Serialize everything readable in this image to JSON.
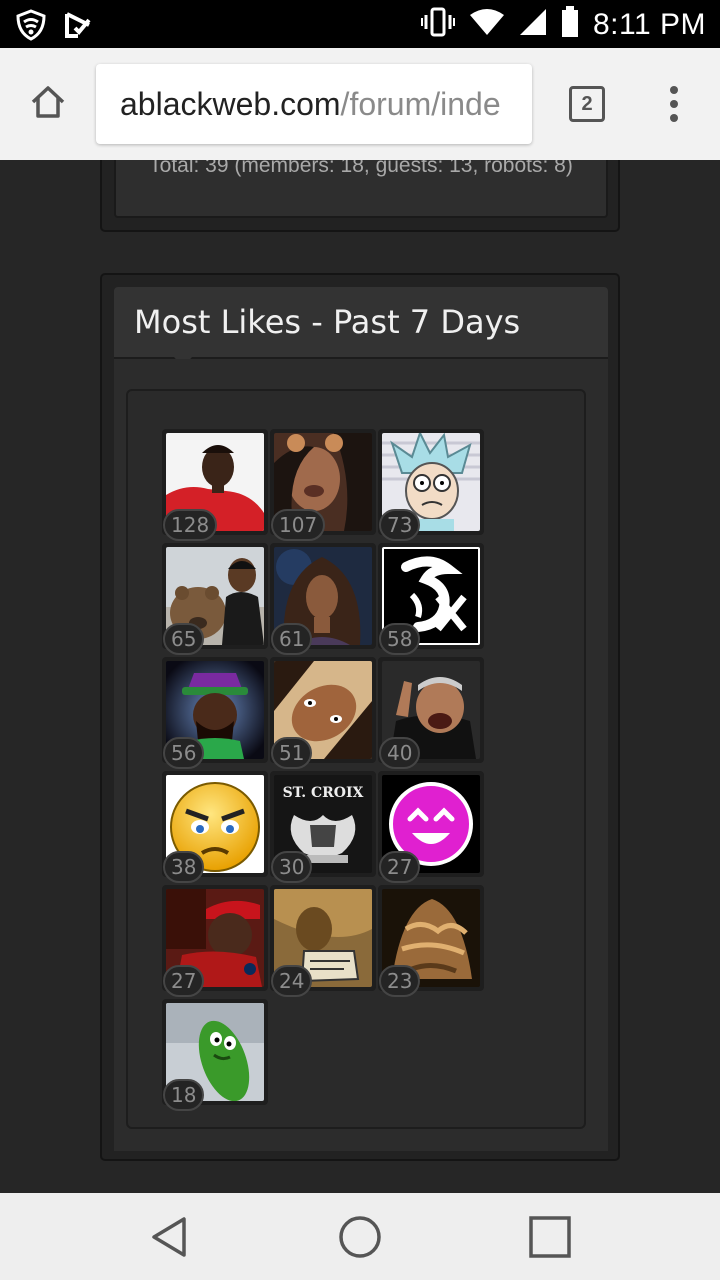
{
  "status_bar": {
    "time": "8:11 PM",
    "icons": [
      "lookout-shield-icon",
      "checklist-icon",
      "vibrate-icon",
      "wifi-icon",
      "cell-signal-icon",
      "battery-icon"
    ]
  },
  "browser": {
    "url_host": "ablackweb.com",
    "url_path": "/forum/inde",
    "tab_count": "2"
  },
  "online": {
    "total_text": "Total: 39 (members: 18, guests: 13, robots: 8)"
  },
  "most_likes": {
    "title": "Most Likes - Past 7 Days",
    "users": [
      {
        "likes": "128",
        "avatar": "red-shirt-man"
      },
      {
        "likes": "107",
        "avatar": "woman-selfie"
      },
      {
        "likes": "73",
        "avatar": "rick-cartoon"
      },
      {
        "likes": "65",
        "avatar": "man-with-bear"
      },
      {
        "likes": "61",
        "avatar": "woman-portrait"
      },
      {
        "likes": "58",
        "avatar": "white-sox-logo"
      },
      {
        "likes": "56",
        "avatar": "green-hat-character"
      },
      {
        "likes": "51",
        "avatar": "tilted-face"
      },
      {
        "likes": "40",
        "avatar": "judge-pointing"
      },
      {
        "likes": "38",
        "avatar": "angry-emoji"
      },
      {
        "likes": "30",
        "avatar": "st-croix-emblem"
      },
      {
        "likes": "27",
        "avatar": "pink-smiley"
      },
      {
        "likes": "27",
        "avatar": "man-red-cap"
      },
      {
        "likes": "24",
        "avatar": "comic-panel"
      },
      {
        "likes": "23",
        "avatar": "golden-creature"
      },
      {
        "likes": "18",
        "avatar": "pickle-rick"
      }
    ],
    "st_croix_text": "ST. CROIX"
  },
  "colors": {
    "page_bg": "#262626",
    "status_bar": "#000000",
    "browser_bar": "#f2f2f2",
    "nav_bar": "#eeeeee"
  }
}
